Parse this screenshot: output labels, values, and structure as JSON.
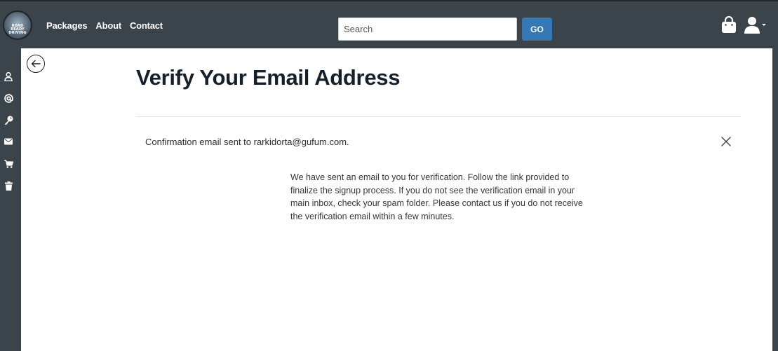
{
  "header": {
    "logo_text": "ROAD READY DRIVING",
    "nav": [
      "Packages",
      "About",
      "Contact"
    ],
    "search": {
      "placeholder": "Search",
      "value": ""
    },
    "go_label": "GO"
  },
  "sidebar": {
    "icons": [
      "user-icon",
      "at-icon",
      "key-icon",
      "envelope-icon",
      "cart-icon",
      "trash-icon"
    ]
  },
  "main": {
    "title": "Verify Your Email Address",
    "alert": "Confirmation email sent to rarkidorta@gufum.com.",
    "body": "We have sent an email to you for verification. Follow the link provided to finalize the signup process. If you do not see the verification email in your main inbox, check your spam folder. Please contact us if you do not receive the verification email within a few minutes."
  },
  "colors": {
    "navbar": "#3b434b",
    "accent": "#3479b3",
    "title": "#16202b"
  }
}
